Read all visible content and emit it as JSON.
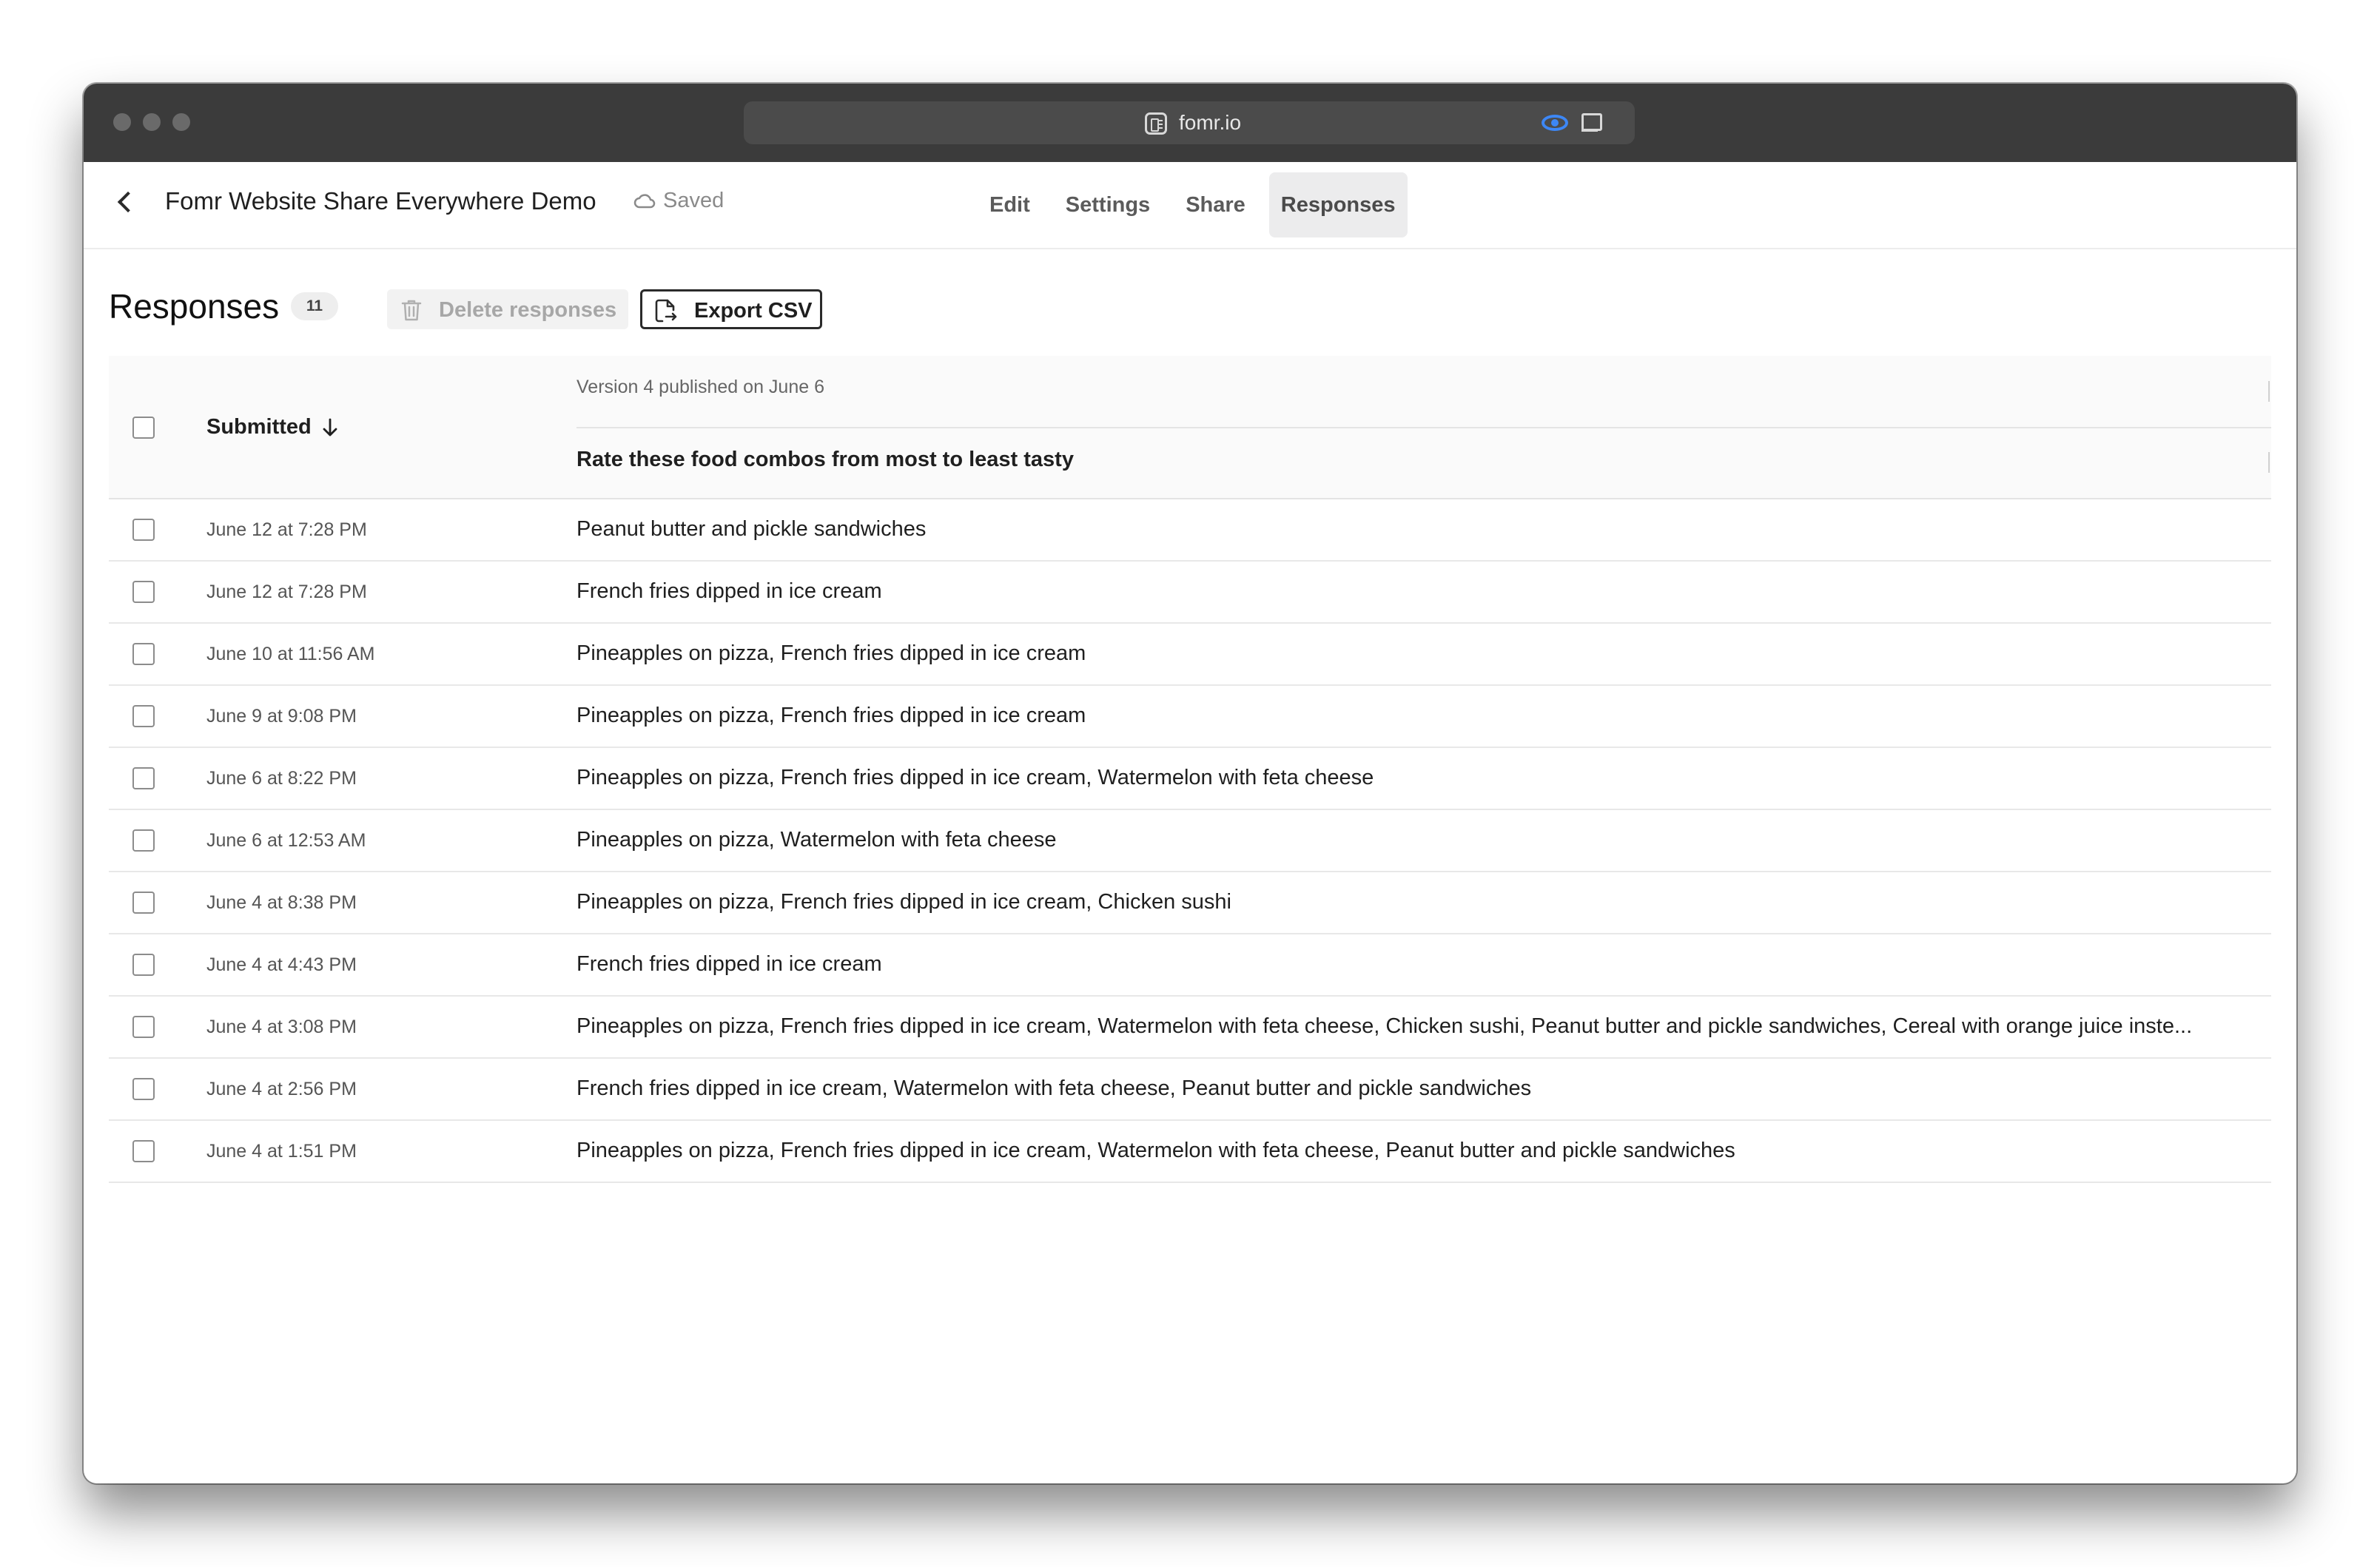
{
  "browser": {
    "url": "fomr.io"
  },
  "header": {
    "form_title": "Fomr Website Share Everywhere Demo",
    "saved_label": "Saved",
    "tabs": [
      {
        "label": "Edit"
      },
      {
        "label": "Settings"
      },
      {
        "label": "Share"
      },
      {
        "label": "Responses"
      }
    ],
    "active_tab": "Responses"
  },
  "toolbar": {
    "title": "Responses",
    "count": "11",
    "delete_label": "Delete responses",
    "export_label": "Export CSV"
  },
  "table": {
    "submitted_header": "Submitted",
    "version_label": "Version 4 published on June 6",
    "question": "Rate these food combos from most to least tasty",
    "rows": [
      {
        "date": "June 12 at 7:28 PM",
        "answer": "Peanut butter and pickle sandwiches"
      },
      {
        "date": "June 12 at 7:28 PM",
        "answer": "French fries dipped in ice cream"
      },
      {
        "date": "June 10 at 11:56 AM",
        "answer": "Pineapples on pizza, French fries dipped in ice cream"
      },
      {
        "date": "June 9 at 9:08 PM",
        "answer": "Pineapples on pizza, French fries dipped in ice cream"
      },
      {
        "date": "June 6 at 8:22 PM",
        "answer": "Pineapples on pizza, French fries dipped in ice cream, Watermelon with feta cheese"
      },
      {
        "date": "June 6 at 12:53 AM",
        "answer": "Pineapples on pizza, Watermelon with feta cheese"
      },
      {
        "date": "June 4 at 8:38 PM",
        "answer": "Pineapples on pizza, French fries dipped in ice cream, Chicken sushi"
      },
      {
        "date": "June 4 at 4:43 PM",
        "answer": "French fries dipped in ice cream"
      },
      {
        "date": "June 4 at 3:08 PM",
        "answer": "Pineapples on pizza, French fries dipped in ice cream, Watermelon with feta cheese, Chicken sushi, Peanut butter and pickle sandwiches, Cereal with orange juice inste..."
      },
      {
        "date": "June 4 at 2:56 PM",
        "answer": "French fries dipped in ice cream, Watermelon with feta cheese, Peanut butter and pickle sandwiches"
      },
      {
        "date": "June 4 at 1:51 PM",
        "answer": "Pineapples on pizza, French fries dipped in ice cream, Watermelon with feta cheese, Peanut butter and pickle sandwiches"
      }
    ]
  },
  "icons": {
    "back": "chevron-left-icon",
    "saved": "cloud-icon",
    "delete": "trash-icon",
    "export": "file-export-icon",
    "sort": "arrow-down-icon",
    "url_site": "form-icon",
    "url_privacy": "eye-icon",
    "url_reader": "reader-icon"
  },
  "colors": {
    "titlebar": "#3b3b3b",
    "active_tab_bg": "#ececed",
    "privacy_icon": "#3d87f5"
  }
}
